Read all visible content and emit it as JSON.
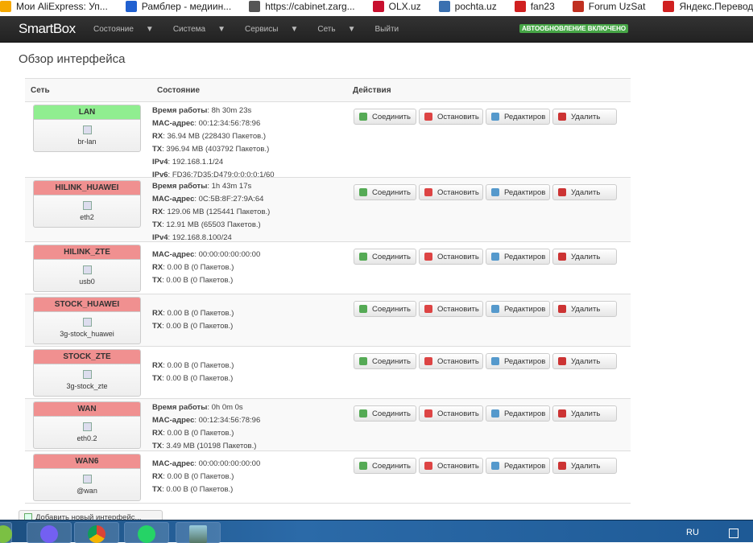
{
  "bookmarks": [
    {
      "label": "Мои AliExpress: Уп...",
      "color": "#f5a800"
    },
    {
      "label": "Рамблер - медиин...",
      "color": "#2060d0"
    },
    {
      "label": "https://cabinet.zarg...",
      "color": "#555"
    },
    {
      "label": "OLX.uz",
      "color": "#c8102e"
    },
    {
      "label": "pochta.uz",
      "color": "#3a70b0"
    },
    {
      "label": "fan23",
      "color": "#d02020"
    },
    {
      "label": "Forum UzSat",
      "color": "#c03020"
    },
    {
      "label": "Яндекс.Переводч",
      "color": "#d02020"
    }
  ],
  "navbar": {
    "brand": "SmartBox",
    "menu": [
      "Состояние",
      "Система",
      "Сервисы",
      "Сеть",
      "Выйти"
    ],
    "caret": "▼",
    "autorefresh": "АВТООБНОВЛЕНИЕ ВКЛЮЧЕНО"
  },
  "page": {
    "title": "Обзор интерфейса"
  },
  "table": {
    "headers": {
      "network": "Сеть",
      "status": "Состояние",
      "actions": "Действия"
    }
  },
  "buttons": {
    "connect": "Соединить",
    "stop": "Остановить",
    "edit": "Редактиров",
    "delete": "Удалить"
  },
  "colors": {
    "up": "#90ee90",
    "down": "#f09090"
  },
  "interfaces": [
    {
      "name": "LAN",
      "up": true,
      "device": "br-lan",
      "stats": [
        [
          "Время работы",
          "8h 30m 23s"
        ],
        [
          "MAC-адрес",
          "00:12:34:56:78:96"
        ],
        [
          "RX",
          "36.94 MB (228430 Пакетов.)"
        ],
        [
          "TX",
          "396.94 MB (403792 Пакетов.)"
        ],
        [
          "IPv4",
          "192.168.1.1/24"
        ],
        [
          "IPv6",
          "FD36:7D35:D479:0:0:0:0:1/60"
        ]
      ]
    },
    {
      "name": "HILINK_HUAWEI",
      "up": false,
      "device": "eth2",
      "stats": [
        [
          "Время работы",
          "1h 43m 17s"
        ],
        [
          "MAC-адрес",
          "0C:5B:8F:27:9A:64"
        ],
        [
          "RX",
          "129.06 MB (125441 Пакетов.)"
        ],
        [
          "TX",
          "12.91 MB (65503 Пакетов.)"
        ],
        [
          "IPv4",
          "192.168.8.100/24"
        ]
      ]
    },
    {
      "name": "HILINK_ZTE",
      "up": false,
      "device": "usb0",
      "stats": [
        [
          "MAC-адрес",
          "00:00:00:00:00:00"
        ],
        [
          "RX",
          "0.00 B (0 Пакетов.)"
        ],
        [
          "TX",
          "0.00 B (0 Пакетов.)"
        ]
      ]
    },
    {
      "name": "STOCK_HUAWEI",
      "up": false,
      "device": "3g-stock_huawei",
      "stats": [
        [
          "RX",
          "0.00 B (0 Пакетов.)"
        ],
        [
          "TX",
          "0.00 B (0 Пакетов.)"
        ]
      ]
    },
    {
      "name": "STOCK_ZTE",
      "up": false,
      "device": "3g-stock_zte",
      "stats": [
        [
          "RX",
          "0.00 B (0 Пакетов.)"
        ],
        [
          "TX",
          "0.00 B (0 Пакетов.)"
        ]
      ]
    },
    {
      "name": "WAN",
      "up": false,
      "device": "eth0.2",
      "stats": [
        [
          "Время работы",
          "0h 0m 0s"
        ],
        [
          "MAC-адрес",
          "00:12:34:56:78:96"
        ],
        [
          "RX",
          "0.00 B (0 Пакетов.)"
        ],
        [
          "TX",
          "3.49 MB (10198 Пакетов.)"
        ]
      ]
    },
    {
      "name": "WAN6",
      "up": false,
      "device": "@wan",
      "stats": [
        [
          "MAC-адрес",
          "00:00:00:00:00:00"
        ],
        [
          "RX",
          "0.00 B (0 Пакетов.)"
        ],
        [
          "TX",
          "0.00 B (0 Пакетов.)"
        ]
      ]
    }
  ],
  "add_interface": "Добавить новый интерфейс...",
  "taskbar": {
    "language": "RU"
  }
}
